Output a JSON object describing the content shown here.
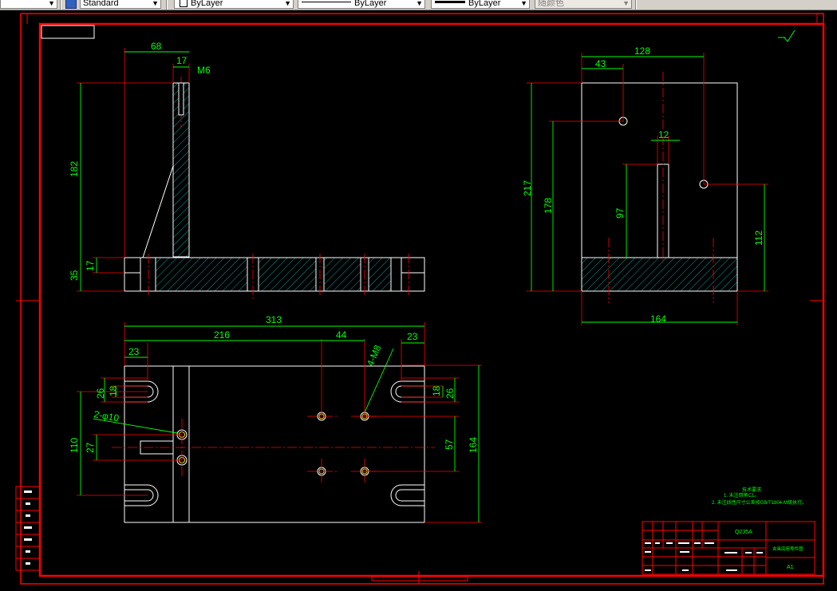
{
  "toolbar": {
    "text_style": "Standard",
    "layer_1": "ByLayer",
    "linetype": "ByLayer",
    "lineweight": "ByLayer",
    "plot_style": "随颜色"
  },
  "colors": {
    "frame": "#ff0000",
    "dimension": "#00ff00",
    "outline": "#ffffff",
    "hatch": "#00d0d0",
    "center": "#ff2020"
  },
  "front_view": {
    "dim_68": "68",
    "dim_17_top": "17",
    "thread": "M6",
    "dim_182": "182",
    "dim_17_side": "17",
    "dim_35": "35"
  },
  "side_view": {
    "dim_128": "128",
    "dim_43": "43",
    "dim_12": "12",
    "dim_217": "217",
    "dim_178": "178",
    "dim_97": "97",
    "dim_112": "112",
    "dim_164": "164"
  },
  "top_view": {
    "dim_313": "313",
    "dim_216": "216",
    "dim_44": "44",
    "dim_23_left": "23",
    "dim_23_right": "23",
    "tapped_holes": "4-M8",
    "dim_26_left": "26",
    "dim_18_left": "18",
    "dim_18_right": "18",
    "dim_26_right": "26",
    "drilled_holes": "2-φ10",
    "dim_110": "110",
    "dim_27": "27",
    "dim_57": "57",
    "dim_164": "164"
  },
  "notes": {
    "title": "技术要求",
    "line1": "1. 未注倒角C1。",
    "line2": "2. 未注线性尺寸公差按GB/T1804-M级执行。"
  },
  "title_block": {
    "material": "Q235A",
    "drawing_name": "夹具底座零件图",
    "sheet_size": "A1"
  }
}
